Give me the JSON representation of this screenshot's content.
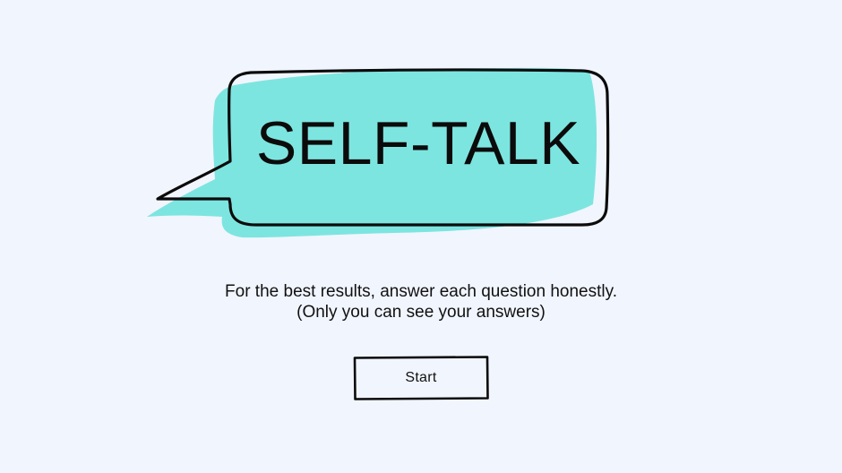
{
  "header": {
    "title": "SELF-TALK"
  },
  "intro": {
    "line1": "For the best results, answer each question honestly.",
    "line2": "(Only you can see your answers)"
  },
  "actions": {
    "start_label": "Start"
  },
  "colors": {
    "background": "#f1f5fe",
    "accent": "#7de5e0",
    "outline": "#0b0b0b"
  }
}
